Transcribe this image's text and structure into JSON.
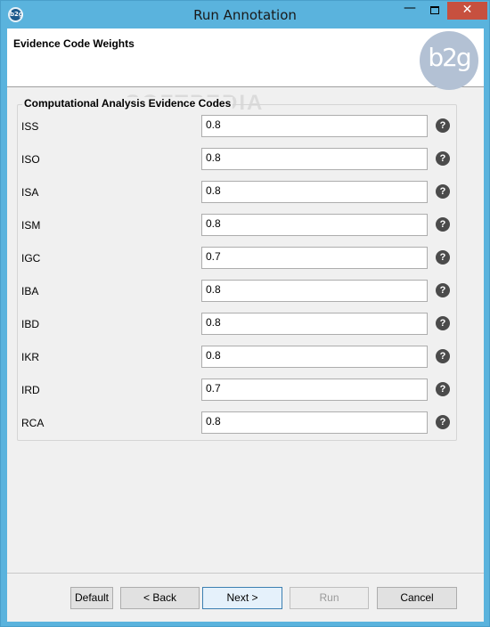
{
  "window": {
    "title": "Run Annotation",
    "app_icon_text": "b2g",
    "minimize_glyph": "—",
    "close_glyph": "✕"
  },
  "header": {
    "title": "Evidence Code Weights",
    "logo_text": "b2g"
  },
  "watermark": "SOFTPEDIA",
  "group": {
    "title": "Computational Analysis Evidence Codes",
    "rows": [
      {
        "code": "ISS",
        "value": "0.8"
      },
      {
        "code": "ISO",
        "value": "0.8"
      },
      {
        "code": "ISA",
        "value": "0.8"
      },
      {
        "code": "ISM",
        "value": "0.8"
      },
      {
        "code": "IGC",
        "value": "0.7"
      },
      {
        "code": "IBA",
        "value": "0.8"
      },
      {
        "code": "IBD",
        "value": "0.8"
      },
      {
        "code": "IKR",
        "value": "0.8"
      },
      {
        "code": "IRD",
        "value": "0.7"
      },
      {
        "code": "RCA",
        "value": "0.8"
      }
    ],
    "help_glyph": "?"
  },
  "buttons": {
    "default": "Default",
    "back": "< Back",
    "next": "Next >",
    "run": "Run",
    "cancel": "Cancel"
  },
  "colors": {
    "title_bar": "#5ab3dd",
    "close_button": "#c7503f",
    "logo": "#b3c1d4",
    "help_icon": "#4b4b4b"
  }
}
